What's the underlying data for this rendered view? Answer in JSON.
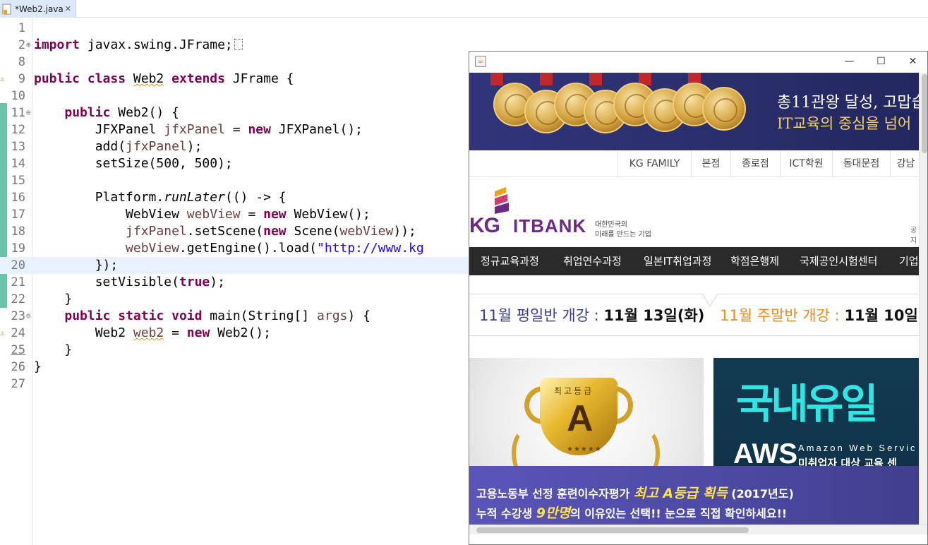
{
  "editor": {
    "tab_title": "*Web2.java",
    "code_lines": [
      {
        "num": "1",
        "code": ""
      },
      {
        "num": "2",
        "code": "import javax.swing.JFrame;"
      },
      {
        "num": "8",
        "code": ""
      },
      {
        "num": "9",
        "code": "public class Web2 extends JFrame {"
      },
      {
        "num": "10",
        "code": ""
      },
      {
        "num": "11",
        "code": "    public Web2() {"
      },
      {
        "num": "12",
        "code": "        JFXPanel jfxPanel = new JFXPanel();"
      },
      {
        "num": "13",
        "code": "        add(jfxPanel);"
      },
      {
        "num": "14",
        "code": "        setSize(500, 500);"
      },
      {
        "num": "15",
        "code": ""
      },
      {
        "num": "16",
        "code": "        Platform.runLater(() -> {"
      },
      {
        "num": "17",
        "code": "            WebView webView = new WebView();"
      },
      {
        "num": "18",
        "code": "            jfxPanel.setScene(new Scene(webView));"
      },
      {
        "num": "19",
        "code": "            webView.getEngine().load(\"http://www.kg"
      },
      {
        "num": "20",
        "code": "        });"
      },
      {
        "num": "21",
        "code": "        setVisible(true);"
      },
      {
        "num": "22",
        "code": "    }"
      },
      {
        "num": "23",
        "code": "    public static void main(String[] args) {"
      },
      {
        "num": "24",
        "code": "        Web2 web2 = new Web2();"
      },
      {
        "num": "25",
        "code": "    }"
      },
      {
        "num": "26",
        "code": "}"
      },
      {
        "num": "27",
        "code": ""
      }
    ]
  },
  "java_window": {
    "window_buttons": {
      "minimize": "—",
      "maximize": "☐",
      "close": "✕"
    },
    "banner": {
      "line1": "총11관왕 달성, 고맙습",
      "line2": "IT교육의 중심을 넘어"
    },
    "top_links": [
      "KG FAMILY",
      "본점",
      "종로점",
      "ICT학원",
      "동대문점",
      "강남"
    ],
    "logo": {
      "kg": "KG",
      "itbank": "ITBANK",
      "tagline1": "대한민국의",
      "tagline2": "미래를 만드는 기업",
      "right_text": "공지"
    },
    "nav": [
      "정규교육과정",
      "취업연수과정",
      "일본IT취업과정",
      "학점은행제",
      "국제공인시험센터",
      "기업"
    ],
    "schedule": {
      "weekday_label": "11월 평일반 개강 :",
      "weekday_date": "11월 13일(화)",
      "weekend_label": "11월 주말반 개강 :",
      "weekend_date": "11월 10일("
    },
    "promo_left": {
      "top_text": "최고등급",
      "grade": "A",
      "stars": "★★★★★"
    },
    "promo_right": {
      "big_text": "국내유일",
      "aws": "AWS",
      "amazon": "Amazon Web Servic",
      "sub": "미취업자 대상 교육 센"
    },
    "promo_bottom": {
      "line1_pre": "고용노동부 선정 훈련이수자평가 ",
      "line1_hl": "최고 A등급 획득",
      "line1_post": " (2017년도)",
      "line2_pre": "누적 수강생 ",
      "line2_hl": "9만명",
      "line2_post": "의 이유있는 선택!!  눈으로 직접 확인하세요!!"
    }
  },
  "colors": {
    "keyword": "#7f0055",
    "field": "#6a3e3e",
    "string": "#2a00ff",
    "nav_bg": "#2a2a2a",
    "brand_purple": "#6a2a86",
    "accent_orange": "#f08a1c"
  }
}
